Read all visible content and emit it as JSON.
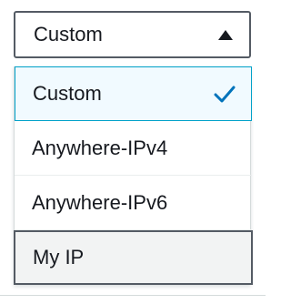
{
  "select": {
    "value": "Custom",
    "caret_icon": "caret-up-icon"
  },
  "options": [
    {
      "label": "Custom",
      "selected": true,
      "check_icon": "check-icon"
    },
    {
      "label": "Anywhere-IPv4",
      "selected": false
    },
    {
      "label": "Anywhere-IPv6",
      "selected": false
    },
    {
      "label": "My IP",
      "selected": false,
      "hovered": true
    }
  ],
  "colors": {
    "selected_border": "#00a1c9",
    "selected_bg": "#f1faff",
    "check": "#0073bb",
    "text": "#16191f"
  }
}
